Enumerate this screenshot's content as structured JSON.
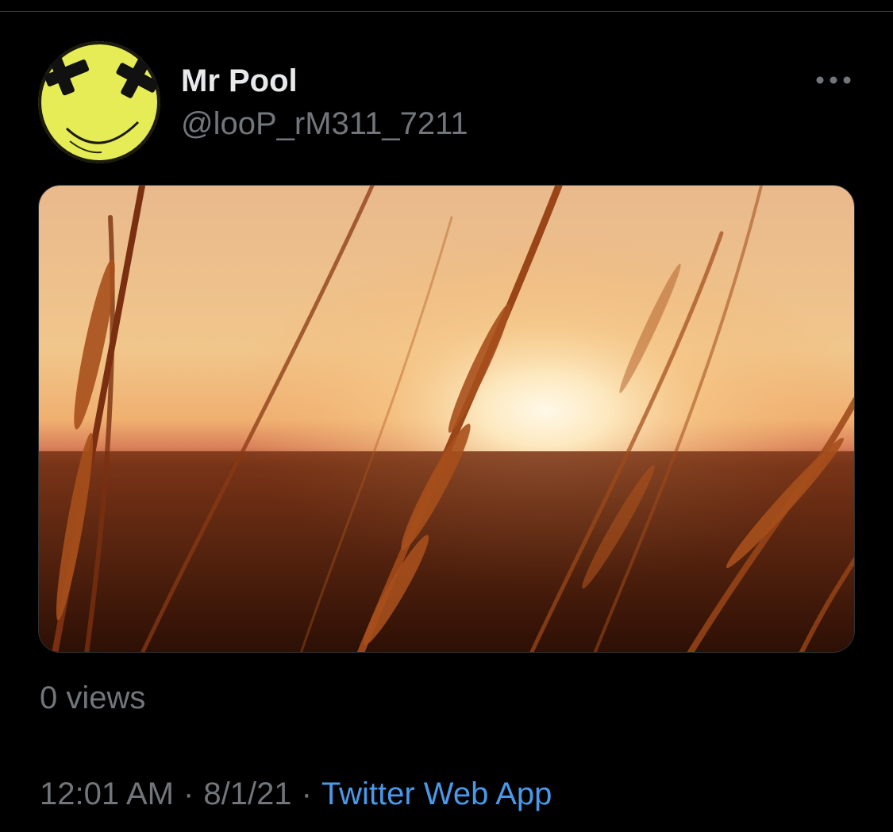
{
  "tweet": {
    "author": {
      "display_name": "Mr Pool",
      "handle": "@looP_rM311_7211"
    },
    "views": "0 views",
    "time": "12:01 AM",
    "date": "8/1/21",
    "separator": "·",
    "source": "Twitter Web App"
  },
  "icons": {
    "more": "more-horizontal-icon",
    "avatar": "yellow-smiley-x-eyes"
  },
  "colors": {
    "background": "#000000",
    "text_primary": "#e7e9ea",
    "text_secondary": "#71767b",
    "link": "#4a99e9",
    "avatar_yellow": "#e6ec55"
  }
}
